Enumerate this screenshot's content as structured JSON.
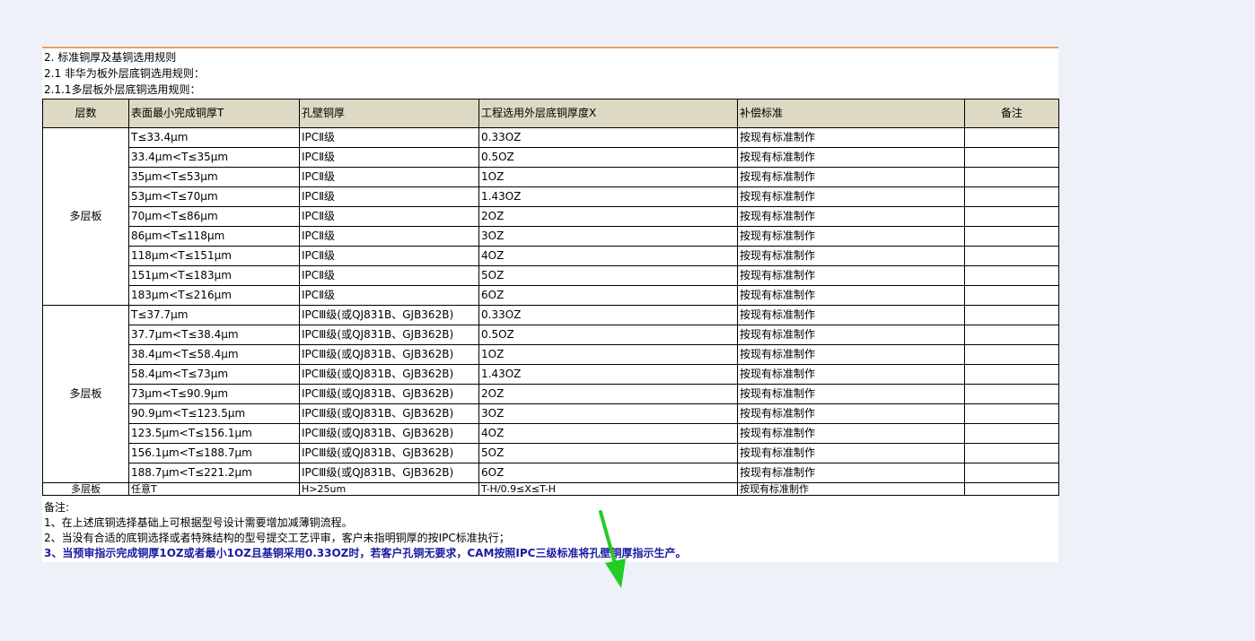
{
  "doc": {
    "heading1": "2. 标准铜厚及基铜选用规则",
    "heading2": "2.1 非华为板外层底铜选用规则：",
    "heading3": "2.1.1多层板外层底铜选用规则："
  },
  "table": {
    "headers": [
      "层数",
      "表面最小完成铜厚T",
      "孔壁铜厚",
      "工程选用外层底铜厚度X",
      "补偿标准",
      "备注"
    ],
    "group1": {
      "label": "多层板",
      "rows": [
        [
          "T≤33.4μm",
          "IPCⅡ级",
          "0.33OZ",
          "按现有标准制作",
          ""
        ],
        [
          "33.4μm<T≤35μm",
          "IPCⅡ级",
          "0.5OZ",
          "按现有标准制作",
          ""
        ],
        [
          "35μm<T≤53μm",
          "IPCⅡ级",
          "1OZ",
          "按现有标准制作",
          ""
        ],
        [
          "53μm<T≤70μm",
          "IPCⅡ级",
          "1.43OZ",
          "按现有标准制作",
          ""
        ],
        [
          "70μm<T≤86μm",
          "IPCⅡ级",
          "2OZ",
          "按现有标准制作",
          ""
        ],
        [
          "86μm<T≤118μm",
          "IPCⅡ级",
          "3OZ",
          "按现有标准制作",
          ""
        ],
        [
          "118μm<T≤151μm",
          "IPCⅡ级",
          "4OZ",
          "按现有标准制作",
          ""
        ],
        [
          "151μm<T≤183μm",
          "IPCⅡ级",
          "5OZ",
          "按现有标准制作",
          ""
        ],
        [
          "183μm<T≤216μm",
          "IPCⅡ级",
          "6OZ",
          "按现有标准制作",
          ""
        ]
      ]
    },
    "group2": {
      "label": "多层板",
      "rows": [
        [
          "T≤37.7μm",
          "IPCⅢ级(或QJ831B、GJB362B)",
          "0.33OZ",
          "按现有标准制作",
          ""
        ],
        [
          "37.7μm<T≤38.4μm",
          "IPCⅢ级(或QJ831B、GJB362B)",
          "0.5OZ",
          "按现有标准制作",
          ""
        ],
        [
          "38.4μm<T≤58.4μm",
          "IPCⅢ级(或QJ831B、GJB362B)",
          "1OZ",
          "按现有标准制作",
          ""
        ],
        [
          "58.4μm<T≤73μm",
          "IPCⅢ级(或QJ831B、GJB362B)",
          "1.43OZ",
          "按现有标准制作",
          ""
        ],
        [
          "73μm<T≤90.9μm",
          "IPCⅢ级(或QJ831B、GJB362B)",
          "2OZ",
          "按现有标准制作",
          ""
        ],
        [
          "90.9μm<T≤123.5μm",
          "IPCⅢ级(或QJ831B、GJB362B)",
          "3OZ",
          "按现有标准制作",
          ""
        ],
        [
          "123.5μm<T≤156.1μm",
          "IPCⅢ级(或QJ831B、GJB362B)",
          "4OZ",
          "按现有标准制作",
          ""
        ],
        [
          "156.1μm<T≤188.7μm",
          "IPCⅢ级(或QJ831B、GJB362B)",
          "5OZ",
          "按现有标准制作",
          ""
        ],
        [
          "188.7μm<T≤221.2μm",
          "IPCⅢ级(或QJ831B、GJB362B)",
          "6OZ",
          "按现有标准制作",
          ""
        ]
      ]
    },
    "last_row": [
      "多层板",
      "任意T",
      "H>25um",
      "T-H/0.9≤X≤T-H",
      "按现有标准制作",
      ""
    ]
  },
  "notes": {
    "title": "备注:",
    "n1": "1、在上述底铜选择基础上可根据型号设计需要增加减薄铜流程。",
    "n2": "2、当没有合适的底铜选择或者特殊结构的型号提交工艺评审，客户未指明铜厚的按IPC标准执行；",
    "n3": "3、当预审指示完成铜厚1OZ或者最小1OZ且基铜采用0.33OZ时，若客户孔铜无要求，CAM按照IPC三级标准将孔壁铜厚指示生产。"
  },
  "colors": {
    "header_bg": "#ddd9c3",
    "note_bold": "#1a1aa0",
    "arrow": "#22cc22",
    "top_border": "#e5a066"
  }
}
